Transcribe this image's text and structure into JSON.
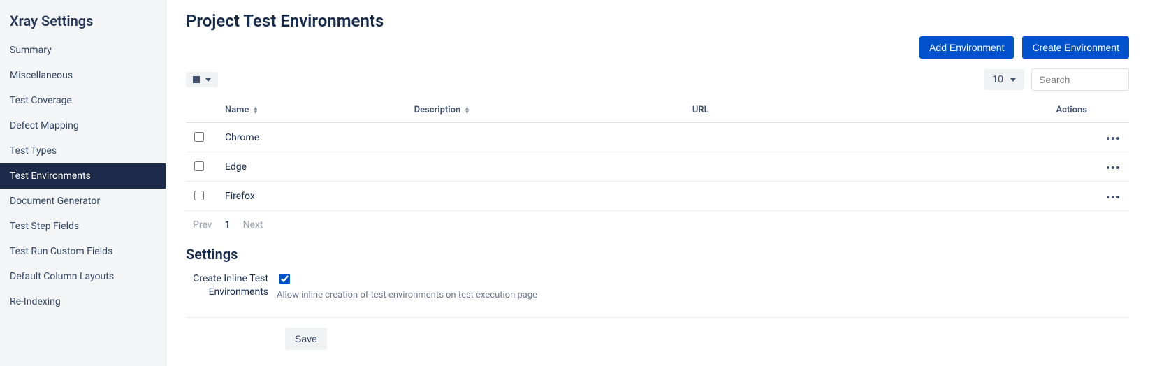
{
  "sidebar": {
    "title": "Xray Settings",
    "items": [
      {
        "label": "Summary",
        "slug": "summary"
      },
      {
        "label": "Miscellaneous",
        "slug": "miscellaneous"
      },
      {
        "label": "Test Coverage",
        "slug": "test-coverage"
      },
      {
        "label": "Defect Mapping",
        "slug": "defect-mapping"
      },
      {
        "label": "Test Types",
        "slug": "test-types"
      },
      {
        "label": "Test Environments",
        "slug": "test-environments",
        "active": true
      },
      {
        "label": "Document Generator",
        "slug": "document-generator"
      },
      {
        "label": "Test Step Fields",
        "slug": "test-step-fields"
      },
      {
        "label": "Test Run Custom Fields",
        "slug": "test-run-custom-fields"
      },
      {
        "label": "Default Column Layouts",
        "slug": "default-column-layouts"
      },
      {
        "label": "Re-Indexing",
        "slug": "re-indexing"
      }
    ]
  },
  "page": {
    "title": "Project Test Environments",
    "add_button": "Add Environment",
    "create_button": "Create Environment",
    "page_size": "10",
    "search_placeholder": "Search"
  },
  "table": {
    "columns": {
      "name": "Name",
      "description": "Description",
      "url": "URL",
      "actions": "Actions"
    },
    "rows": [
      {
        "name": "Chrome",
        "description": "",
        "url": ""
      },
      {
        "name": "Edge",
        "description": "",
        "url": ""
      },
      {
        "name": "Firefox",
        "description": "",
        "url": ""
      }
    ]
  },
  "pagination": {
    "prev": "Prev",
    "next": "Next",
    "current": "1"
  },
  "settings": {
    "title": "Settings",
    "inline_label": "Create Inline Test Environments",
    "inline_desc": "Allow inline creation of test environments on test execution page",
    "inline_checked": true,
    "save_button": "Save"
  }
}
